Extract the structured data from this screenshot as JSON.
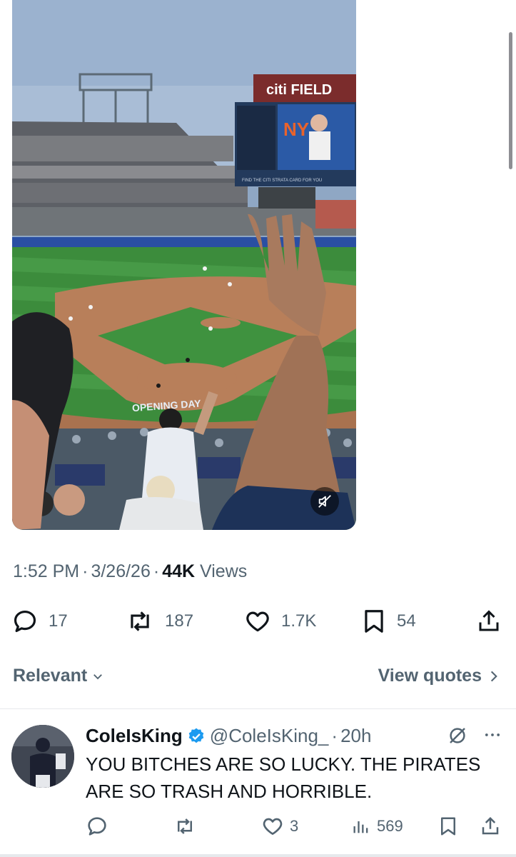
{
  "media": {
    "scoreboard_brand": "citi FIELD",
    "scoreboard_caption": "FIND THE CITI STRATA CARD FOR YOU",
    "field_logo": "OPENING DAY",
    "mute_icon": "speaker-muted-icon"
  },
  "post": {
    "time": "1:52 PM",
    "date": "3/26/26",
    "views_count": "44K",
    "views_label": "Views"
  },
  "actions": {
    "replies": "17",
    "reposts": "187",
    "likes": "1.7K",
    "bookmarks": "54"
  },
  "sort": {
    "label": "Relevant",
    "view_quotes": "View quotes"
  },
  "reply": {
    "display_name": "ColeIsKing",
    "handle": "@ColeIsKing_",
    "time": "20h",
    "text": "YOU BITCHES ARE SO LUCKY. THE PIRATES ARE SO TRASH AND HORRIBLE.",
    "likes": "3",
    "views": "569"
  },
  "colors": {
    "text_primary": "#0f1419",
    "text_secondary": "#536471",
    "verified_blue": "#1d9bf0",
    "divider": "#e6e9ec"
  }
}
